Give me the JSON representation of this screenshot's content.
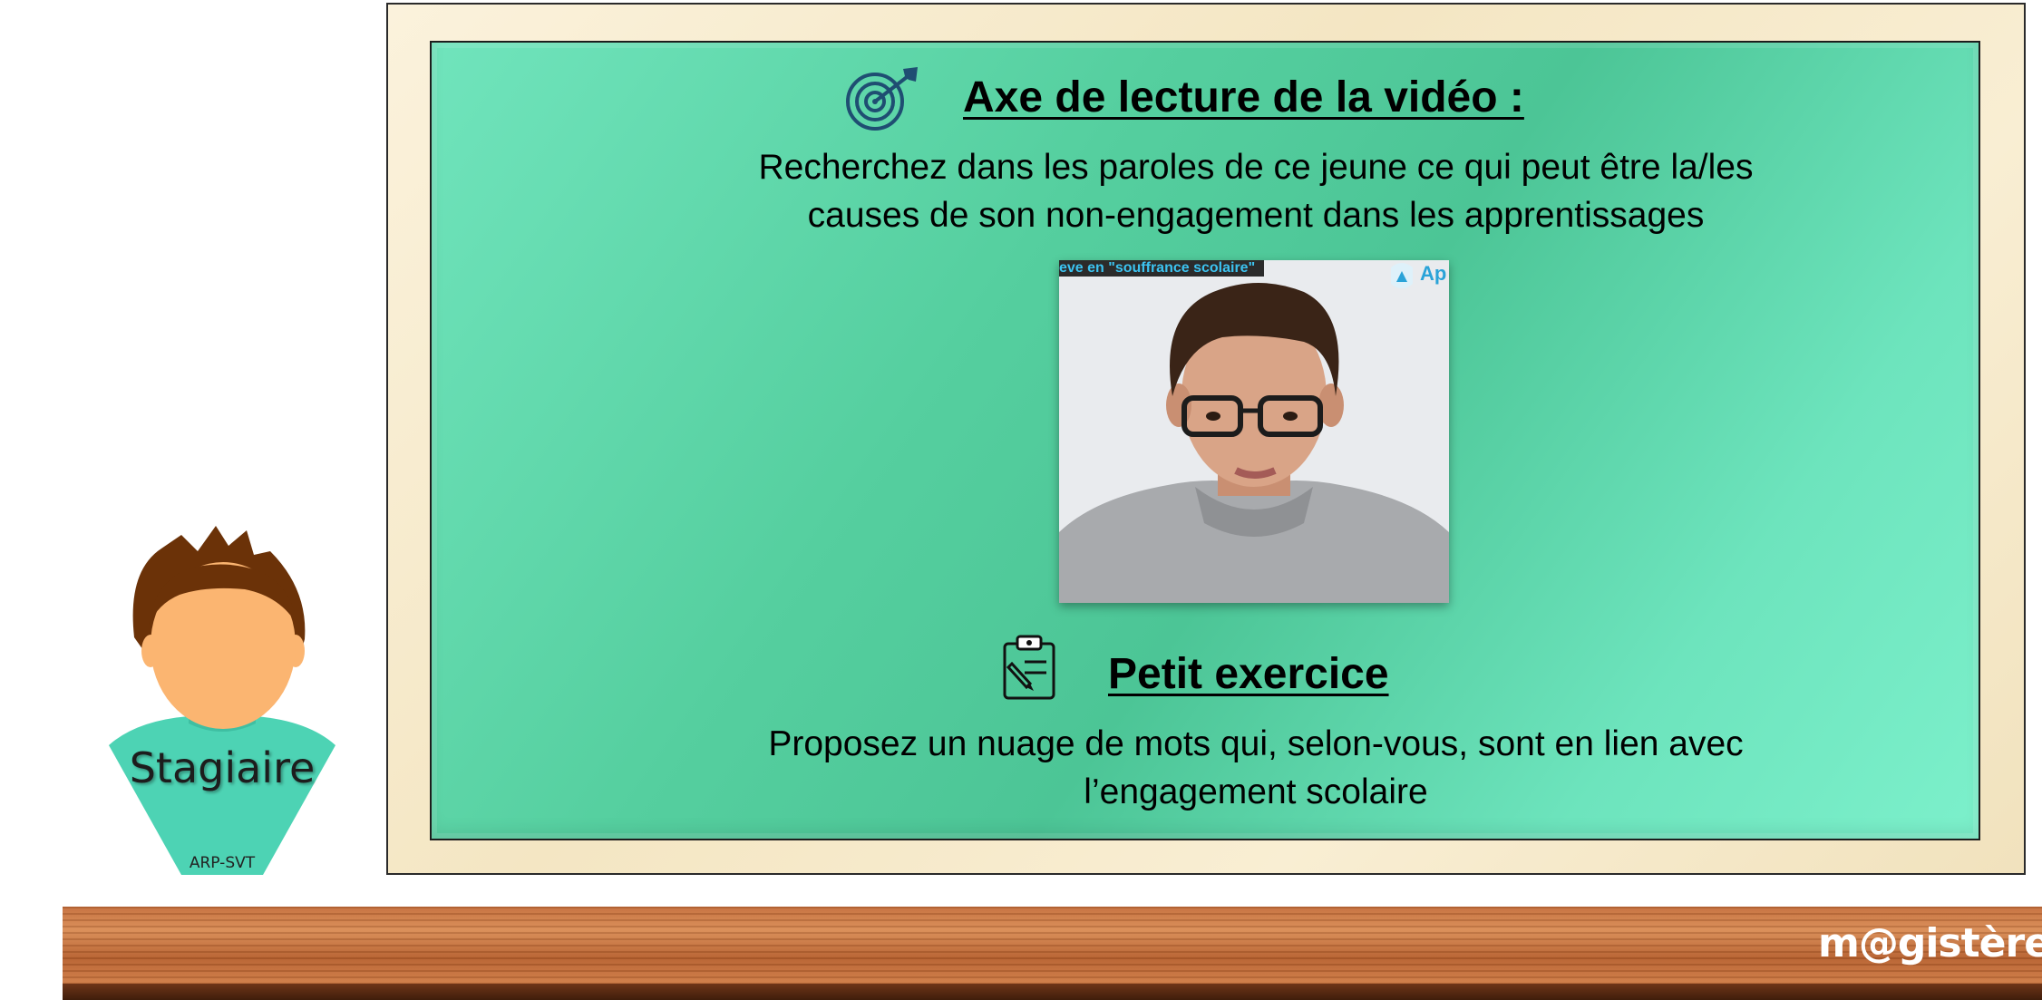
{
  "character": {
    "name": "Stagiaire",
    "tag": "ARP-SVT"
  },
  "board": {
    "section1": {
      "heading": "Axe de lecture de la vidéo :",
      "text_line1": "Recherchez dans les paroles de ce jeune ce qui peut être la/les",
      "text_line2": "causes de son non-engagement dans les apprentissages",
      "icon": "target-icon"
    },
    "video": {
      "caption": "eve en \"souffrance scolaire\"",
      "logo_text": "Ap"
    },
    "section2": {
      "heading": "Petit exercice",
      "text_line1": "Proposez un nuage de mots qui, selon-vous, sont en lien avec",
      "text_line2": "l’engagement scolaire",
      "icon": "clipboard-icon"
    }
  },
  "brand": {
    "logo": "m@gistère"
  },
  "colors": {
    "board_green": "#55cf9f",
    "frame_cream": "#f7ebcf",
    "shirt_teal": "#4dd3b4",
    "hair_brown": "#6b3208",
    "skin": "#fbb571",
    "icon_navy": "#1f4e72"
  }
}
